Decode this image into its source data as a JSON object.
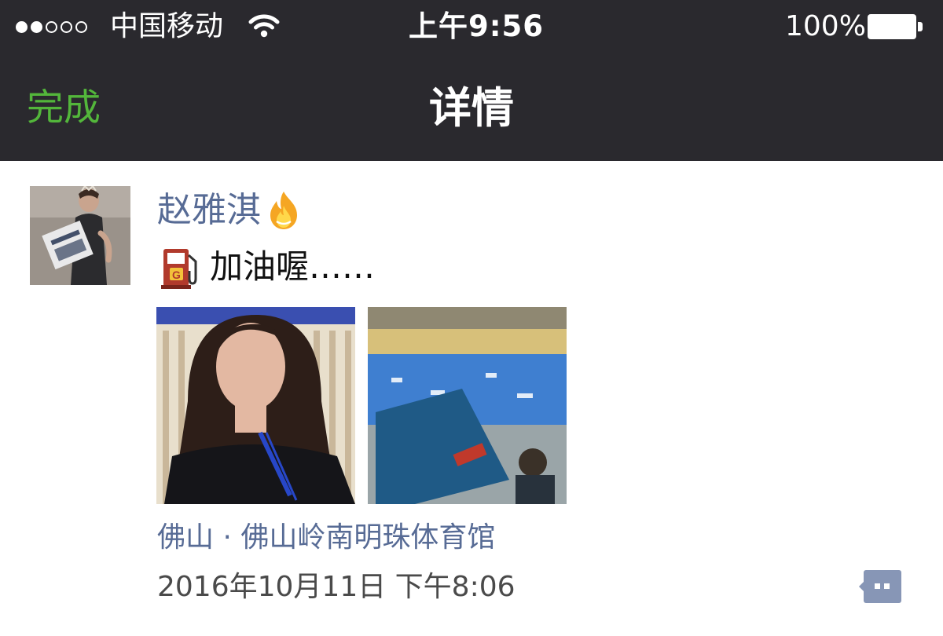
{
  "status_bar": {
    "carrier": "中国移动",
    "time": "上午9:56",
    "battery": "100%",
    "signal_strength": 2,
    "signal_total": 5
  },
  "nav": {
    "done_label": "完成",
    "title": "详情"
  },
  "post": {
    "author": "赵雅淇",
    "text": "加油喔……",
    "photos": [
      "selfie-photo",
      "arena-photo"
    ],
    "location": "佛山 · 佛山岭南明珠体育馆",
    "timestamp": "2016年10月11日 下午8:06"
  },
  "icons": {
    "wifi": "wifi-icon",
    "battery": "battery-icon",
    "fire": "fire-icon",
    "fuel": "fuel-pump-icon",
    "comment": "comment-icon"
  },
  "colors": {
    "header_bg": "#2a292e",
    "done": "#53b63b",
    "link": "#576b95",
    "comment_button": "#8796b6"
  }
}
